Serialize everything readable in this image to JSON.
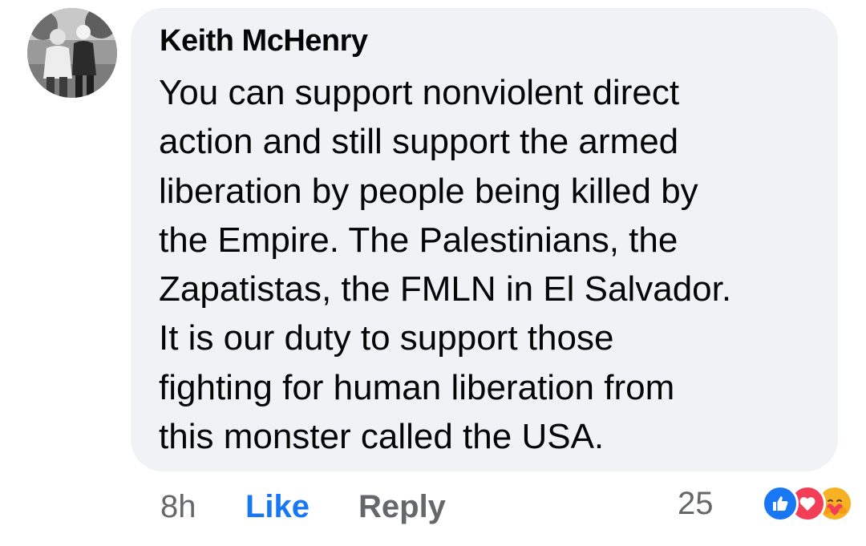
{
  "comment": {
    "author": "Keith McHenry",
    "lines": [
      "You can support nonviolent direct",
      "action and still support the armed",
      "liberation by people being killed by",
      "the Empire. The Palestinians, the",
      "Zapatistas, the FMLN in El Salvador.",
      "It is our duty to support those",
      "fighting for human liberation from",
      "this monster called the USA."
    ]
  },
  "actions": {
    "time": "8h",
    "like_label": "Like",
    "reply_label": "Reply"
  },
  "reactions": {
    "count": "25",
    "icons": [
      "like-icon",
      "love-icon",
      "care-icon"
    ]
  },
  "colors": {
    "bubble": "#f0f2f5",
    "like_blue": "#1877f2",
    "secondary_text": "#65676b",
    "love_red": "#f33e58",
    "care_yellow": "#f7b125"
  }
}
